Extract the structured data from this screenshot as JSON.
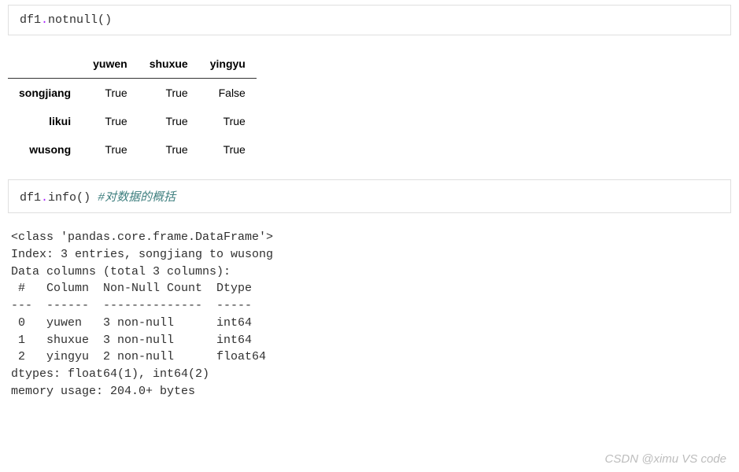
{
  "cell1": {
    "obj": "df1",
    "dot": ".",
    "method": "notnull",
    "open": "(",
    "close": ")"
  },
  "table1": {
    "columns": [
      "yuwen",
      "shuxue",
      "yingyu"
    ],
    "index": [
      "songjiang",
      "likui",
      "wusong"
    ],
    "rows": [
      [
        "True",
        "True",
        "False"
      ],
      [
        "True",
        "True",
        "True"
      ],
      [
        "True",
        "True",
        "True"
      ]
    ]
  },
  "cell2": {
    "obj": "df1",
    "dot": ".",
    "method": "info",
    "open": "(",
    "close": ")",
    "spacer": "  ",
    "comment": "#对数据的概括"
  },
  "info_output": {
    "line1": "<class 'pandas.core.frame.DataFrame'>",
    "line2": "Index: 3 entries, songjiang to wusong",
    "line3": "Data columns (total 3 columns):",
    "line4": " #   Column  Non-Null Count  Dtype  ",
    "line5": "---  ------  --------------  -----  ",
    "line6": " 0   yuwen   3 non-null      int64  ",
    "line7": " 1   shuxue  3 non-null      int64  ",
    "line8": " 2   yingyu  2 non-null      float64",
    "line9": "dtypes: float64(1), int64(2)",
    "line10": "memory usage: 204.0+ bytes"
  },
  "watermark": "CSDN @ximu VS code"
}
